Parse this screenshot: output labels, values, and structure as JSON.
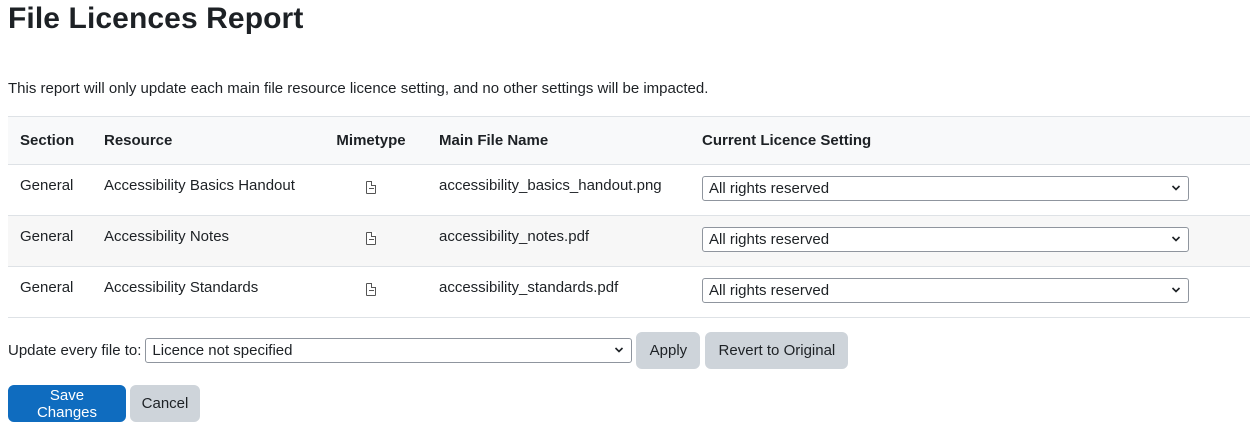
{
  "page": {
    "title": "File Licences Report",
    "intro": "This report will only update each main file resource licence setting, and no other settings will be impacted."
  },
  "table": {
    "headers": {
      "section": "Section",
      "resource": "Resource",
      "mimetype": "Mimetype",
      "main_file_name": "Main File Name",
      "current_licence": "Current Licence Setting"
    },
    "rows": [
      {
        "section": "General",
        "resource": "Accessibility Basics Handout",
        "mimetype_icon": "image-file-icon",
        "main_file_name": "accessibility_basics_handout.png",
        "licence": "All rights reserved"
      },
      {
        "section": "General",
        "resource": "Accessibility Notes",
        "mimetype_icon": "pdf-file-icon",
        "main_file_name": "accessibility_notes.pdf",
        "licence": "All rights reserved"
      },
      {
        "section": "General",
        "resource": "Accessibility Standards",
        "mimetype_icon": "pdf-file-icon",
        "main_file_name": "accessibility_standards.pdf",
        "licence": "All rights reserved"
      }
    ]
  },
  "bulk_update": {
    "label": "Update every file to:",
    "selected": "Licence not specified",
    "apply_label": "Apply",
    "revert_label": "Revert to Original"
  },
  "actions": {
    "save_label": "Save Changes",
    "cancel_label": "Cancel"
  },
  "colors": {
    "primary": "#0f6cbf",
    "secondary_button": "#ced4da",
    "header_row_bg": "#f8f9fa",
    "striped_row_bg": "#f7f7f7"
  }
}
